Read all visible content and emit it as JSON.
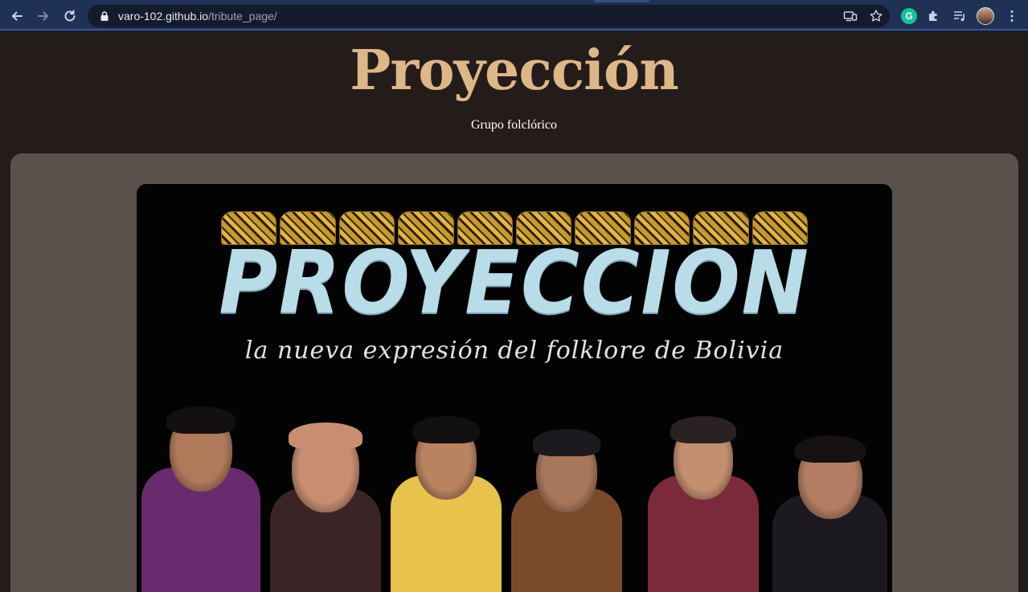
{
  "browser": {
    "url_host": "varo-102.github.io",
    "url_path": "/tribute_page/",
    "grammarly_letter": "G"
  },
  "page": {
    "title": "Proyección",
    "subtitle": "Grupo folclórico"
  },
  "image": {
    "logo_text": "PROYECCION",
    "tagline": "la nueva expresión del folklore de Bolivia",
    "members": [
      {
        "skin": "#b07a5a",
        "hair": "#141010",
        "shirt": "#6a2a6e"
      },
      {
        "skin": "#c98e72",
        "hair": "#c98e72",
        "shirt": "#3a2426"
      },
      {
        "skin": "#b98360",
        "hair": "#121010",
        "shirt": "#e8c24a"
      },
      {
        "skin": "#a8765a",
        "hair": "#1c1a1e",
        "shirt": "#7a4a2a"
      },
      {
        "skin": "#c48e70",
        "hair": "#2a2222",
        "shirt": "#7a2a3a"
      },
      {
        "skin": "#b27d62",
        "hair": "#161214",
        "shirt": "#1c1a20"
      }
    ]
  },
  "colors": {
    "title": "#deb787",
    "panel": "#5a514d",
    "page_bg": "#241c1b",
    "chrome_bg": "#1f3155"
  }
}
